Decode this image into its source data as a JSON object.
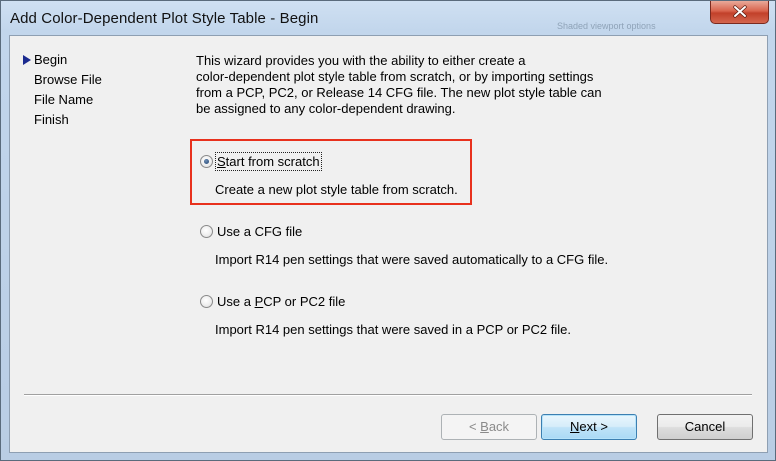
{
  "window": {
    "title": "Add Color-Dependent Plot Style Table - Begin",
    "background_hint_text": "Shaded viewport options"
  },
  "nav": {
    "items": [
      "Begin",
      "Browse File",
      "File Name",
      "Finish"
    ],
    "current": "Begin"
  },
  "intro": {
    "lines": [
      "This wizard provides you with the ability to either create a",
      "color-dependent plot style table from scratch, or by importing settings",
      "from a PCP, PC2, or Release 14 CFG file. The new plot style table can",
      "be assigned to any color-dependent drawing."
    ]
  },
  "options": [
    {
      "label": "Start from scratch",
      "mnemonic": "S",
      "description": "Create a new plot style table from scratch.",
      "selected": true
    },
    {
      "label": "Use a CFG file",
      "mnemonic": "",
      "description": "Import R14 pen settings that were saved automatically to a CFG file.",
      "selected": false
    },
    {
      "label": "Use a PCP or PC2 file",
      "mnemonic": "P",
      "description": "Import R14 pen settings that were saved in a PCP or PC2 file.",
      "selected": false
    }
  ],
  "buttons": {
    "back": {
      "pre": "< ",
      "mnemonic": "B",
      "post": "ack",
      "enabled": false
    },
    "next": {
      "pre": "",
      "mnemonic": "N",
      "post": "ext >",
      "enabled": true
    },
    "cancel": {
      "label": "Cancel"
    }
  },
  "colors": {
    "highlight_box": "#e8311d",
    "close_button": "#c7432d"
  }
}
